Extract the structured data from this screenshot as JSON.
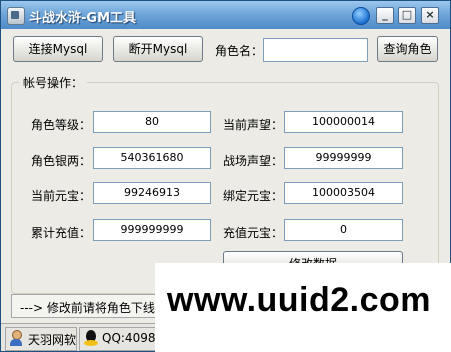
{
  "window": {
    "title": "斗战水浒-GM工具",
    "controls": {
      "minimize": "_",
      "maximize": "□",
      "close": "×"
    }
  },
  "toolbar": {
    "connect_label": "连接Mysql",
    "disconnect_label": "断开Mysql",
    "role_name_label": "角色名：",
    "role_name_value": "",
    "query_label": "查询角色"
  },
  "account": {
    "group_title": "帐号操作：",
    "fields": [
      {
        "label": "角色等级：",
        "value": "80"
      },
      {
        "label": "当前声望：",
        "value": "100000014"
      },
      {
        "label": "角色银两：",
        "value": "540361680"
      },
      {
        "label": "战场声望：",
        "value": "99999999"
      },
      {
        "label": "当前元宝：",
        "value": "99246913"
      },
      {
        "label": "绑定元宝：",
        "value": "100003504"
      },
      {
        "label": "累计充值：",
        "value": "999999999"
      },
      {
        "label": "充值元宝：",
        "value": "0"
      }
    ],
    "modify_label": "修改数据"
  },
  "status": {
    "message": "---> 修改前请将角色下线"
  },
  "bottom": {
    "author": "天羽网软",
    "qq": "QQ:409840"
  },
  "watermark": "www.uuid2.com"
}
